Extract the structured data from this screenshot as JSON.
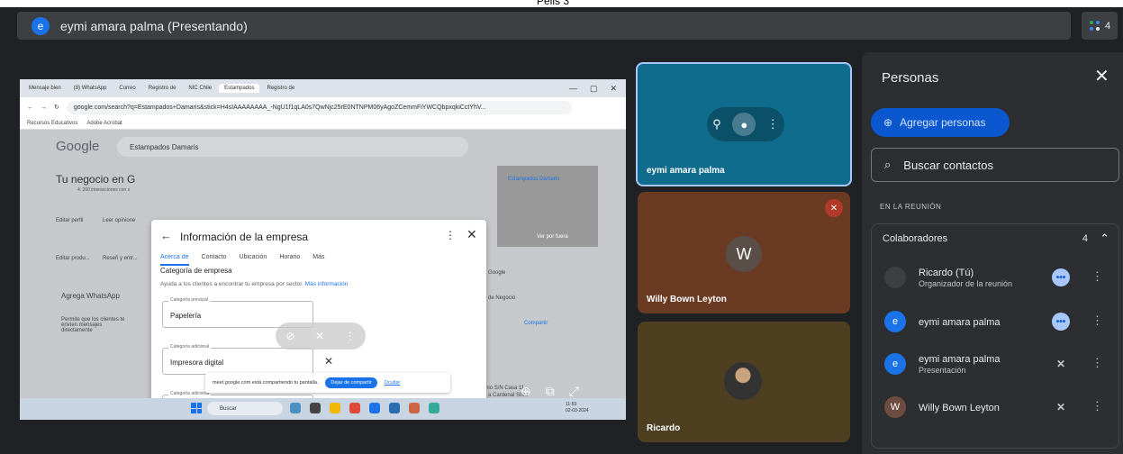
{
  "window": {
    "top_label": "Pelis 3"
  },
  "presenter_bar": {
    "avatar": "e",
    "text": "eymi amara palma (Presentando)",
    "people_count": "4"
  },
  "shared_screen": {
    "chrome_tabs": [
      "Mensaje bien",
      "(8) WhatsApp",
      "Correo",
      "Registro de",
      "NIC Chile",
      "Estampados",
      "Registro de"
    ],
    "url": "google.com/search?q=Estampados+Damaris&stick=H4sIAAAAAAAA_-NgU1f1qLA0s7QwNjc25rE0NTNPM06yAgoZCemmFiYWCQbpxqkiCctYhV...",
    "bookmarks": [
      "Recursos Educativos",
      "Adobe Acrobat"
    ],
    "google_logo": "Google",
    "search_text": "Estampados Damaris",
    "business_title": "Tu negocio en G",
    "business_sub": "4. 200 interacciones con s",
    "left_items": [
      "Editar perfil",
      "Leer opinione",
      "Editar produ...",
      "Reseñ y entr..."
    ],
    "whatsapp_title": "Agrega WhatsApp",
    "whatsapp_desc": "Permite que los clientes te envíen mensajes directamente",
    "right_panel_label": "Estampados Damaris",
    "right_panel_sub": "Ver por fuera",
    "bg_texts": [
      "Google",
      "de Negocio",
      "Compartir",
      "saje San Antonio S/N Casa 11 ...",
      "a Cardenal Silva"
    ],
    "modal": {
      "title": "Información de la empresa",
      "tabs": [
        "Acerca de",
        "Contacto",
        "Ubicación",
        "Horario",
        "Más"
      ],
      "section": "Categoría de empresa",
      "help": "Ayuda a los clientes a encontrar tu empresa por sector.",
      "help_link": "Más información",
      "fields": [
        {
          "label": "Categoría principal",
          "value": "Papelería"
        },
        {
          "label": "Categoría adicional",
          "value": "Impresora digital"
        },
        {
          "label": "Categoría adicional",
          "value": ""
        }
      ]
    },
    "share_notice": {
      "text": "meet.google.com está compartiendo tu pantalla.",
      "stop": "Dejar de compartir",
      "hide": "Ocultar"
    },
    "taskbar": {
      "search": "Buscar",
      "time": "11:59",
      "date": "02-03-2024"
    }
  },
  "tiles": [
    {
      "name": "eymi amara palma"
    },
    {
      "name": "Willy Bown Leyton",
      "avatar": "W"
    },
    {
      "name": "Ricardo"
    }
  ],
  "people_panel": {
    "title": "Personas",
    "add_button": "Agregar personas",
    "search_placeholder": "Buscar contactos",
    "section_label": "EN LA REUNIÓN",
    "group_title": "Colaboradores",
    "group_count": "4",
    "participants": [
      {
        "name": "Ricardo (Tú)",
        "sub": "Organizador de la reunión",
        "avatar": "",
        "avatar_color": "#3c4043",
        "status": "speaking"
      },
      {
        "name": "eymi amara palma",
        "sub": "",
        "avatar": "e",
        "avatar_color": "#1a73e8",
        "status": "speaking"
      },
      {
        "name": "eymi amara palma",
        "sub": "Presentación",
        "avatar": "e",
        "avatar_color": "#1a73e8",
        "status": "muted-sound"
      },
      {
        "name": "Willy Bown Leyton",
        "sub": "",
        "avatar": "W",
        "avatar_color": "#6d4c41",
        "status": "muted"
      }
    ]
  },
  "colors": {
    "accent": "#0b57d0",
    "background": "#202124",
    "panel": "#2d2e31"
  }
}
